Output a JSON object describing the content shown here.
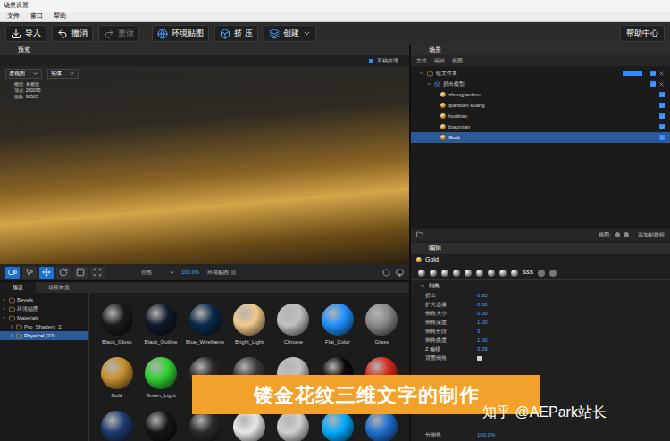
{
  "window": {
    "title": "场景设置"
  },
  "menu": [
    "文件",
    "窗口",
    "帮助"
  ],
  "toolbar": {
    "buttons": [
      {
        "label": "导入",
        "icon": "import",
        "disabled": false,
        "dropdown": false
      },
      {
        "label": "撤消",
        "icon": "undo",
        "disabled": false,
        "dropdown": false
      },
      {
        "label": "重做",
        "icon": "redo",
        "disabled": true,
        "dropdown": false
      },
      {
        "label": "环境贴图",
        "icon": "globe",
        "disabled": false,
        "dropdown": false
      },
      {
        "label": "挤 压",
        "icon": "extrude",
        "disabled": false,
        "dropdown": false
      },
      {
        "label": "创建",
        "icon": "create",
        "disabled": false,
        "dropdown": true
      }
    ],
    "help": "帮助中心"
  },
  "preview": {
    "title": "预览",
    "draft": {
      "label": "草稿纹理",
      "checked": true
    },
    "view": "透视图",
    "shading": "实体",
    "stats": [
      "模型: 多模型",
      "顶点: 280095",
      "面数: 93565"
    ],
    "tools": [
      {
        "kind": "camera",
        "selected": true
      },
      {
        "kind": "select",
        "selected": false
      },
      {
        "kind": "move",
        "selected": true
      },
      {
        "kind": "rotate",
        "selected": false
      },
      {
        "kind": "frame",
        "selected": false
      },
      {
        "kind": "scale",
        "selected": false
      }
    ],
    "lighting": "自然",
    "zoom": "100.0%",
    "env": {
      "label": "环境贴图",
      "checked": false
    }
  },
  "library": {
    "tabs": [
      {
        "label": "预设",
        "selected": true
      },
      {
        "label": "场景材质",
        "selected": false
      }
    ],
    "tree": [
      {
        "label": "Bevels",
        "depth": 0,
        "selected": false
      },
      {
        "label": "环境贴图",
        "depth": 0,
        "selected": false
      },
      {
        "label": "Materials",
        "depth": 0,
        "selected": false
      },
      {
        "label": "Pro_Shaders_2",
        "depth": 1,
        "selected": false
      },
      {
        "label": "Physical (22)",
        "depth": 1,
        "selected": true
      }
    ],
    "materials": [
      [
        {
          "label": "Black_Gloss",
          "color": "#1a1a1a"
        },
        {
          "label": "Black_Outline",
          "color": "#101828"
        },
        {
          "label": "Blue_Wireframe",
          "color": "#0b2a4a"
        },
        {
          "label": "Bright_Light",
          "color": "#f2c98a"
        },
        {
          "label": "Chrome",
          "color": "#bfbfbf"
        },
        {
          "label": "Flat_Color",
          "color": "#1e90ff"
        },
        {
          "label": "Glass",
          "color": "#8a8a8a"
        }
      ],
      [
        {
          "label": "Gold",
          "color": "#c8902e"
        },
        {
          "label": "Green_Light",
          "color": "#2fd12f"
        },
        {
          "color": "#2b2b2b"
        },
        {
          "color": "#3c3c3c"
        },
        {
          "color": "#c0c0c0"
        },
        {
          "color": "#0a0a0a"
        },
        {
          "color": "#d42a1a"
        }
      ],
      [
        {
          "color": "#1e3a6e"
        },
        {
          "color": "#151515"
        },
        {
          "color": "#2a2a2a"
        },
        {
          "color": "#e8e8e8"
        },
        {
          "color": "#d0d0d0"
        },
        {
          "color": "#00aaff"
        },
        {
          "color": "#1f6fd0"
        }
      ]
    ]
  },
  "scene": {
    "title": "场景",
    "menu": [
      "文件",
      "编辑",
      "视图"
    ],
    "tree": [
      {
        "label": "组文件夹",
        "depth": 0,
        "kind": "group",
        "selected": false,
        "visible": true
      },
      {
        "label": "挤出模型",
        "depth": 1,
        "kind": "model",
        "selected": false,
        "visible": true
      },
      {
        "label": "zhongjianhou",
        "depth": 2,
        "kind": "material",
        "selected": false,
        "visible": true
      },
      {
        "label": "qianbian kuang",
        "depth": 2,
        "kind": "material",
        "selected": false,
        "visible": true
      },
      {
        "label": "houbian",
        "depth": 2,
        "kind": "material",
        "selected": false,
        "visible": true
      },
      {
        "label": "biaomian",
        "depth": 2,
        "kind": "material",
        "selected": false,
        "visible": true
      },
      {
        "label": "Gold",
        "depth": 2,
        "kind": "material",
        "selected": true,
        "visible": true
      }
    ],
    "view_label": "视图:",
    "add": "添加到群组"
  },
  "editor": {
    "title": "编辑",
    "object": "Gold",
    "sss": "SSS",
    "section": "剖角",
    "props": [
      {
        "label": "挤出",
        "value": "0.35",
        "kind": "number"
      },
      {
        "label": "扩大边缘",
        "value": "0.00",
        "kind": "number"
      },
      {
        "label": "倒角大小",
        "value": "0.00",
        "kind": "number"
      },
      {
        "label": "倒角深度",
        "value": "1.00",
        "kind": "number"
      },
      {
        "label": "倒角分段",
        "value": "3",
        "kind": "number"
      },
      {
        "label": "倒角曲度",
        "value": "1.00",
        "kind": "number"
      },
      {
        "label": "Z 偏移",
        "value": "3.29",
        "kind": "number"
      },
      {
        "label": "背面倒角",
        "kind": "checkbox",
        "checked": true
      }
    ],
    "footer": {
      "label": "分倒角",
      "value": "100.0%"
    }
  },
  "overlay": {
    "banner": "镂金花纹三维文字的制作",
    "watermark": "知乎 @AEPark站长"
  }
}
